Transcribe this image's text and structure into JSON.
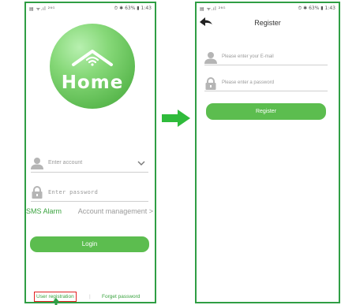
{
  "left_screen": {
    "status_left": "▤ ᯤ.ıl ²⁶ᴳ",
    "status_right": "⏱ ✱ 63% ▮ 1:43",
    "logo_text": "Home",
    "account_placeholder": "Enter account",
    "password_placeholder": "Enter password",
    "sms_alarm": "SMS Alarm",
    "account_management": "Account management >",
    "login_label": "Login",
    "user_registration": "User registration",
    "divider": "|",
    "forgot_password": "Forget password"
  },
  "right_screen": {
    "status_left": "▤ ᯤ.ıl ²⁶ᴳ",
    "status_right": "⏱ ✱ 63% ▮ 1:43",
    "title": "Register",
    "email_placeholder": "Please enter your E-mail",
    "password_placeholder": "Please enter a password",
    "register_label": "Register"
  },
  "colors": {
    "accent_green": "#5cbd4f",
    "frame_green": "#2f9e44",
    "highlight_red": "#e02020"
  },
  "icons": [
    "house-wifi-icon",
    "user-icon",
    "lock-icon",
    "chevron-down-icon",
    "back-arrow-icon",
    "arrow-right-icon",
    "arrow-up-icon"
  ]
}
